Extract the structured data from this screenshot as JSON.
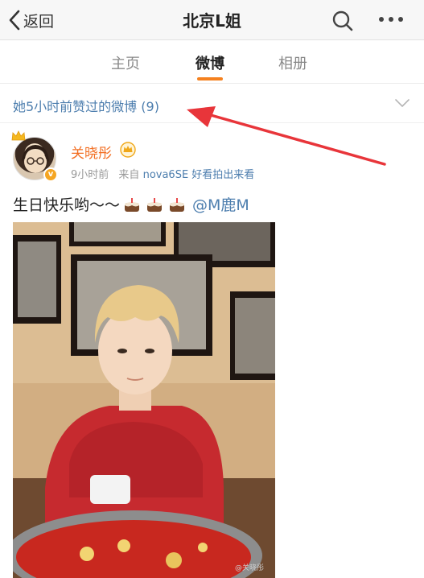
{
  "nav": {
    "back_label": "返回",
    "title": "北京L姐",
    "icons": [
      "chevron-left-icon",
      "search-icon",
      "more-icon"
    ]
  },
  "tabs": [
    {
      "label": "主页",
      "active": false
    },
    {
      "label": "微博",
      "active": true
    },
    {
      "label": "相册",
      "active": false
    }
  ],
  "liked_bar": {
    "text": "她5小时前赞过的微博 (9)"
  },
  "post": {
    "user_name": "关晓彤",
    "time": "9小时前",
    "source_prefix": "来自",
    "source": "nova6SE 好看拍出来看",
    "text": "生日快乐哟～～",
    "mention": "@M鹿M",
    "emoji_count": 3,
    "watermark": "@关晓彤"
  },
  "colors": {
    "accent_orange": "#f5811f",
    "username_orange": "#f26e22",
    "link_blue": "#4d7eae",
    "annotation_red": "#e8353a"
  }
}
